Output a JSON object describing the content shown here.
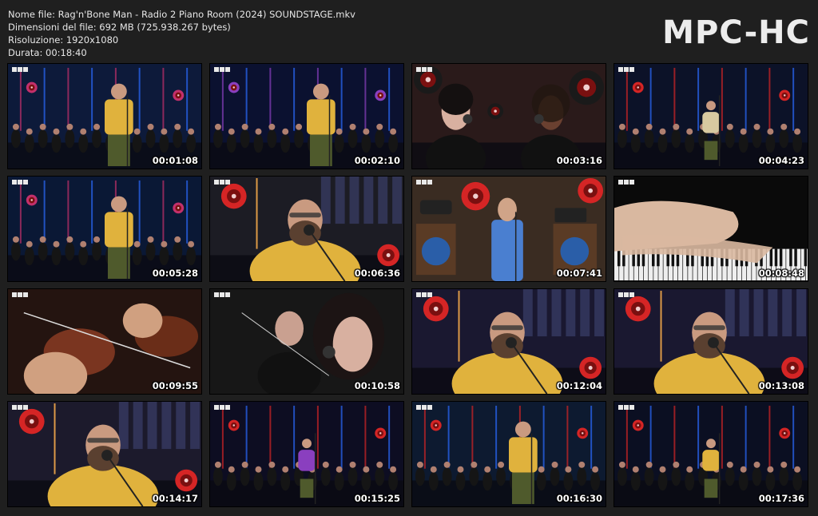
{
  "info": {
    "filename": "Nome file: Rag'n'Bone Man - Radio 2 Piano Room (2024) SOUNDSTAGE.mkv",
    "filesize": "Dimensioni del file: 692 MB (725.938.267 bytes)",
    "resolution": "Risoluzione: 1920x1080",
    "duration": "Durata: 00:18:40"
  },
  "brand": "MPC-HC",
  "thumbnails": [
    {
      "time": "00:01:08",
      "scene": "singer-orchestra",
      "colors": [
        "#0d1a3a",
        "#e0b23d",
        "#c3306b"
      ]
    },
    {
      "time": "00:02:10",
      "scene": "singer-orchestra-wide",
      "colors": [
        "#0b1130",
        "#e0b23d",
        "#8a3fbf"
      ]
    },
    {
      "time": "00:03:16",
      "scene": "backing-singers",
      "colors": [
        "#2a1a1a",
        "#d52525",
        "#1a1a1a"
      ]
    },
    {
      "time": "00:04:23",
      "scene": "stage-wide",
      "colors": [
        "#0c1228",
        "#d8c9a0",
        "#d52525"
      ]
    },
    {
      "time": "00:05:28",
      "scene": "singer-orchestra",
      "colors": [
        "#0a1835",
        "#e0b23d",
        "#c3306b"
      ]
    },
    {
      "time": "00:06:36",
      "scene": "singer-closeup",
      "colors": [
        "#1c1c24",
        "#e0b23d",
        "#d52525"
      ]
    },
    {
      "time": "00:07:41",
      "scene": "presenter",
      "colors": [
        "#3a2a20",
        "#4a7fd0",
        "#d52525"
      ]
    },
    {
      "time": "00:08:48",
      "scene": "piano-hands",
      "colors": [
        "#0a0a0a",
        "#d9b8a0",
        "#ffffff"
      ]
    },
    {
      "time": "00:09:55",
      "scene": "violins",
      "colors": [
        "#2b1410",
        "#8a3a22",
        "#d0a080"
      ]
    },
    {
      "time": "00:10:58",
      "scene": "singer-violinist",
      "colors": [
        "#141414",
        "#c9a090",
        "#202020"
      ]
    },
    {
      "time": "00:12:04",
      "scene": "singer-closeup",
      "colors": [
        "#1a1830",
        "#e0b23d",
        "#d52525"
      ]
    },
    {
      "time": "00:13:08",
      "scene": "singer-closeup",
      "colors": [
        "#1a1830",
        "#e0b23d",
        "#d52525"
      ]
    },
    {
      "time": "00:14:17",
      "scene": "singer-closeup",
      "colors": [
        "#1c1a2c",
        "#e0b23d",
        "#d52525"
      ]
    },
    {
      "time": "00:15:25",
      "scene": "stage-wide",
      "colors": [
        "#0d0d22",
        "#8a3fbf",
        "#d52525"
      ]
    },
    {
      "time": "00:16:30",
      "scene": "singer-orchestra-wide",
      "colors": [
        "#0d1a30",
        "#e0b23d",
        "#d52525"
      ]
    },
    {
      "time": "00:17:36",
      "scene": "stage-wide",
      "colors": [
        "#0b0f22",
        "#e0b23d",
        "#d52525"
      ]
    }
  ]
}
